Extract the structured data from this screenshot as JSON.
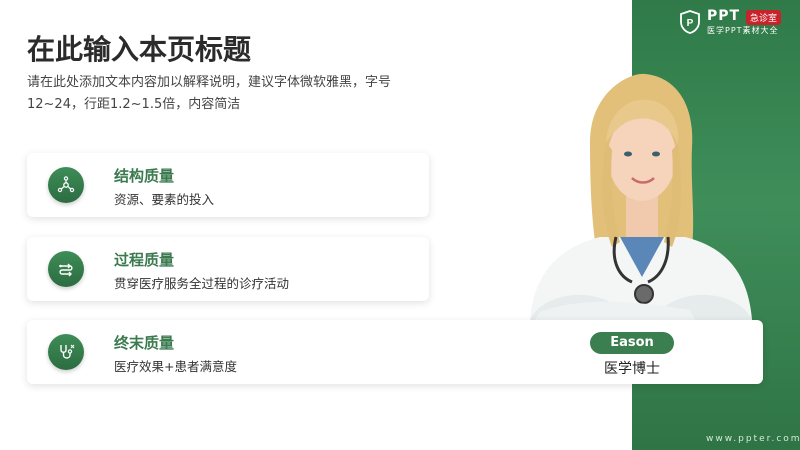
{
  "slide": {
    "title": "在此输入本页标题",
    "description": "请在此处添加文本内容加以解释说明，建议字体微软雅黑，字号12~24，行距1.2~1.5倍，内容简洁"
  },
  "brand": {
    "logo_text": "PPT",
    "badge_text": "急诊室",
    "tagline": "医学PPT素材大全",
    "website": "www.ppter.com"
  },
  "cards": [
    {
      "heading": "结构质量",
      "text": "资源、要素的投入",
      "icon": "network-icon"
    },
    {
      "heading": "过程质量",
      "text": "贯穿医疗服务全过程的诊疗活动",
      "icon": "process-loop-icon"
    },
    {
      "heading": "终末质量",
      "text": "医疗效果+患者满意度",
      "icon": "stethoscope-icon"
    }
  ],
  "person": {
    "name": "Eason",
    "role": "医学博士"
  },
  "colors": {
    "accent": "#3a7a4e",
    "panel": "#3f8e5a",
    "badge": "#c8222a"
  }
}
